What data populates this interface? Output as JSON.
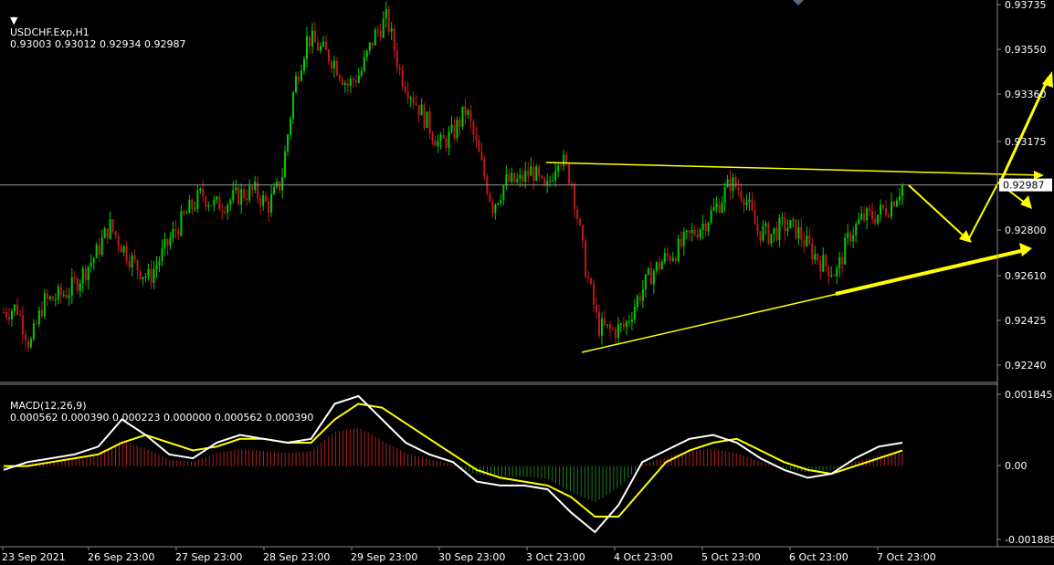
{
  "main_header": {
    "symbol": "USDCHF.Exp,H1",
    "values": "0.93003 0.93012 0.92934 0.92987"
  },
  "macd_header": {
    "name": "MACD(12,26,9)",
    "values": "0.000562 0.000390 0.000223 0.000000 0.000562 0.000390"
  },
  "price_axis": {
    "labels": [
      "0.93735",
      "0.93550",
      "0.93360",
      "0.93175",
      "0.92800",
      "0.92610",
      "0.92425",
      "0.92240"
    ],
    "current_price": "0.92987"
  },
  "macd_axis": {
    "labels": [
      "0.001845",
      "0.00",
      "-0.001888"
    ]
  },
  "time_axis": {
    "labels": [
      "23 Sep 2021",
      "26 Sep 23:00",
      "27 Sep 23:00",
      "28 Sep 23:00",
      "29 Sep 23:00",
      "30 Sep 23:00",
      "3 Oct 23:00",
      "4 Oct 23:00",
      "5 Oct 23:00",
      "6 Oct 23:00",
      "7 Oct 23:00"
    ]
  },
  "colors": {
    "background": "#000000",
    "bull": "#00cc00",
    "bear": "#c01a1a",
    "annotation": "#ffff00",
    "macd_line": "#ffffff",
    "signal_line": "#ffff00",
    "hist_positive": "#b02020",
    "hist_negative": "#1f7a1f",
    "grid": "#8a8a8a"
  },
  "chart_data": [
    {
      "type": "candlestick",
      "title": "USDCHF.Exp,H1",
      "ylim": [
        0.9222,
        0.9375
      ],
      "x": [
        "23 Sep 2021",
        "26 Sep 23:00",
        "27 Sep 23:00",
        "28 Sep 23:00",
        "29 Sep 23:00",
        "30 Sep 23:00",
        "3 Oct 23:00",
        "4 Oct 23:00",
        "5 Oct 23:00",
        "6 Oct 23:00",
        "7 Oct 23:00"
      ],
      "close_path": [
        0.9246,
        0.9248,
        0.9232,
        0.925,
        0.9252,
        0.9255,
        0.9262,
        0.927,
        0.9282,
        0.9273,
        0.9265,
        0.926,
        0.927,
        0.928,
        0.9288,
        0.9295,
        0.929,
        0.9292,
        0.9295,
        0.9296,
        0.929,
        0.93,
        0.934,
        0.936,
        0.9355,
        0.935,
        0.934,
        0.9345,
        0.936,
        0.9368,
        0.9345,
        0.9335,
        0.9325,
        0.9315,
        0.932,
        0.933,
        0.931,
        0.929,
        0.93,
        0.93,
        0.9305,
        0.9295,
        0.9312,
        0.93,
        0.9265,
        0.924,
        0.9238,
        0.924,
        0.9252,
        0.9262,
        0.9268,
        0.9272,
        0.9278,
        0.9283,
        0.929,
        0.93,
        0.9295,
        0.928,
        0.9278,
        0.9282,
        0.928,
        0.9272,
        0.9266,
        0.9262,
        0.9278,
        0.9285,
        0.9286,
        0.929,
        0.92987
      ],
      "annotations": {
        "current_price_line": 0.92987,
        "resistance_line": [
          [
            "3 Oct",
            0.93115
          ],
          [
            "projection",
            0.9305
          ]
        ],
        "support_line": [
          [
            "3 Oct",
            0.9229
          ],
          [
            "projection",
            0.9275
          ]
        ],
        "forecast_arrows": "zigzag down then up"
      }
    },
    {
      "type": "line",
      "title": "MACD(12,26,9)",
      "ylim": [
        -0.001888,
        0.001845
      ],
      "series": [
        {
          "name": "MACD",
          "values": [
            -0.0001,
            0.0001,
            0.0002,
            0.0003,
            0.0005,
            0.0012,
            0.0008,
            0.0003,
            0.0002,
            0.0006,
            0.0008,
            0.0007,
            0.0006,
            0.0007,
            0.0016,
            0.0018,
            0.0012,
            0.0006,
            0.0003,
            0.0001,
            -0.0004,
            -0.0005,
            -0.0005,
            -0.0006,
            -0.0012,
            -0.0017,
            -0.001,
            0.0001,
            0.0004,
            0.0007,
            0.0008,
            0.0006,
            0.0002,
            -0.0001,
            -0.0003,
            -0.0002,
            0.0002,
            0.0005,
            0.0006
          ]
        },
        {
          "name": "Signal",
          "values": [
            0.0,
            0.0,
            0.0001,
            0.0002,
            0.0003,
            0.0006,
            0.0008,
            0.0006,
            0.0004,
            0.0005,
            0.0007,
            0.0007,
            0.0006,
            0.0006,
            0.0012,
            0.0016,
            0.0015,
            0.0011,
            0.0007,
            0.0003,
            -0.0001,
            -0.0003,
            -0.0004,
            -0.0005,
            -0.0008,
            -0.0013,
            -0.0013,
            -0.0006,
            0.0001,
            0.0004,
            0.0006,
            0.0007,
            0.0004,
            0.0001,
            -0.0001,
            -0.0002,
            0.0,
            0.0002,
            0.0004
          ]
        }
      ]
    }
  ]
}
